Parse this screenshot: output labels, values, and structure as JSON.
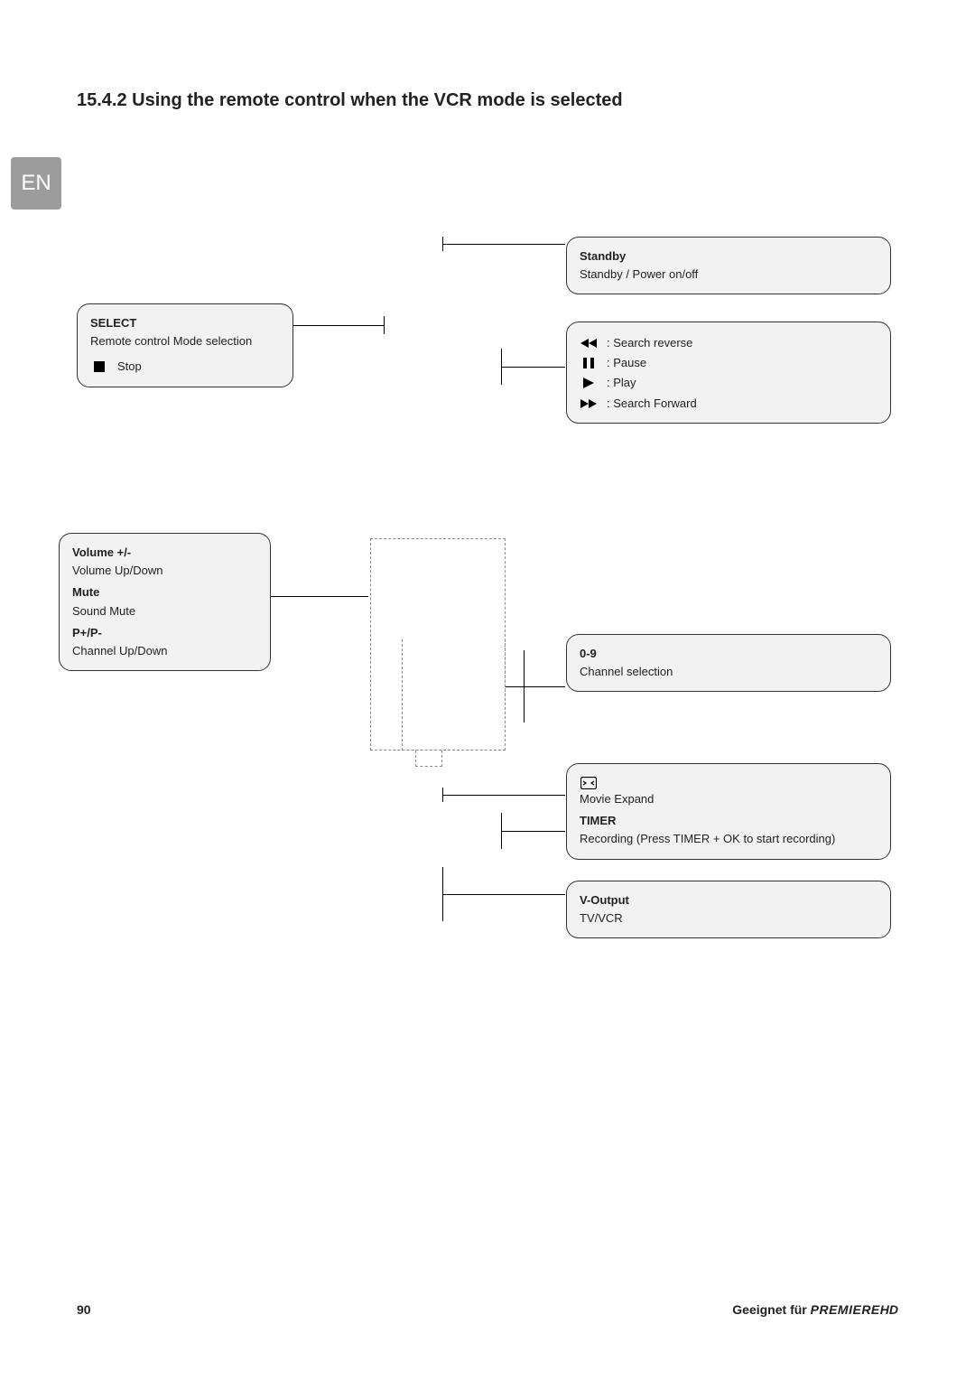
{
  "heading": "15.4.2 Using the remote control when the VCR mode is selected",
  "lang_tab": "EN",
  "standby": {
    "title": "Standby",
    "desc": "Standby / Power on/off"
  },
  "select": {
    "title": "SELECT",
    "desc": "Remote control Mode selection",
    "stop": "Stop"
  },
  "transport": {
    "rev": ": Search reverse",
    "pause": ": Pause",
    "play": ": Play",
    "fwd": ": Search Forward"
  },
  "volume": {
    "title": "Volume    +/-",
    "desc": "Volume Up/Down",
    "mute_title": "Mute",
    "mute_desc": "Sound Mute",
    "chan_title": "P+/P-",
    "chan_desc": "Channel Up/Down"
  },
  "numeric": {
    "title": "0-9",
    "desc": "Channel selection"
  },
  "movie_timer": {
    "movie_desc": "Movie Expand",
    "timer_title": "TIMER",
    "timer_desc": "Recording (Press TIMER + OK to start recording)"
  },
  "voutput": {
    "title": "V-Output",
    "desc": "TV/VCR"
  },
  "page_number": "90",
  "footer": {
    "prefix": "Geeignet für ",
    "brand": "PREMIERE",
    "suffix": "HD"
  }
}
